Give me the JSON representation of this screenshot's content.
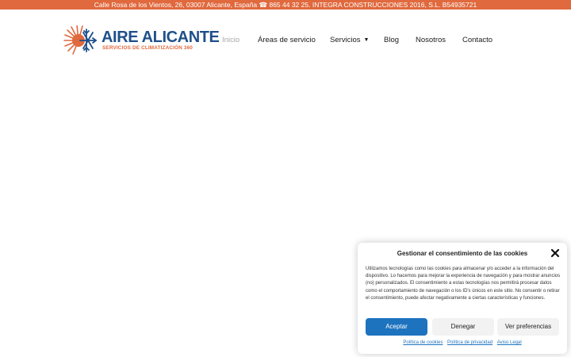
{
  "topbar": {
    "text": "Calle Rosa de los Vientos, 26, 03007 Alicante, España ☎ 865 44 32 25. INTEGRA CONSTRUCCIONES 2016, S.L. B54935721"
  },
  "logo": {
    "title": "AIRE ALICANTE",
    "subtitle": "SERVICIOS DE CLIMATIZACIÓN 360",
    "colors": {
      "title": "#1f4f8a",
      "accent": "#e0693e"
    }
  },
  "nav": {
    "items": [
      {
        "label": "Inicio",
        "active": true
      },
      {
        "label": "Áreas de servicio"
      },
      {
        "label": "Servicios",
        "has_dropdown": true
      },
      {
        "label": "Blog"
      },
      {
        "label": "Nosotros"
      },
      {
        "label": "Contacto"
      }
    ]
  },
  "cookie_banner": {
    "title": "Gestionar el consentimiento de las cookies",
    "body": "Utilizamos tecnologías como las cookies para almacenar y/o acceder a la información del dispositivo. Lo hacemos para mejorar la experiencia de navegación y para mostrar anuncios (no) personalizados. El consentimiento a estas tecnologías nos permitirá procesar datos como el comportamiento de navegación o los ID's únicos en este sitio. No consentir o retirar el consentimiento, puede afectar negativamente a ciertas características y funciones.",
    "buttons": {
      "accept": "Aceptar",
      "deny": "Denegar",
      "preferences": "Ver preferencias"
    },
    "links": {
      "cookie_policy": "Política de cookies",
      "privacy_policy": "Política de privacidad",
      "legal_notice": "Aviso Legal"
    },
    "colors": {
      "primary": "#1e73be"
    }
  },
  "colors": {
    "topbar_bg": "#e0693e",
    "nav_active": "#a8a8a8"
  }
}
